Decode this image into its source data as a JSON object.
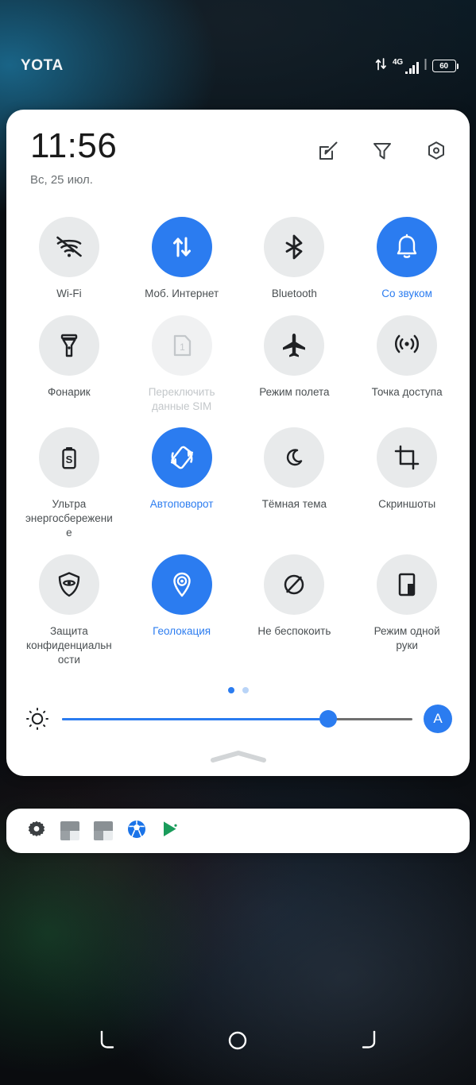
{
  "statusbar": {
    "carrier": "YOTA",
    "network_type": "4G",
    "battery_level": "60",
    "data_icon": "data-transfer-icon"
  },
  "panel": {
    "clock": "11:56",
    "date": "Вс, 25 июл.",
    "actions": [
      {
        "name": "edit-tiles-icon",
        "label": "Изменить"
      },
      {
        "name": "filter-icon",
        "label": "Фильтр"
      },
      {
        "name": "settings-icon",
        "label": "Настройки"
      }
    ]
  },
  "tiles": [
    {
      "label": "Wi-Fi",
      "icon": "wifi-off-icon",
      "state": "off"
    },
    {
      "label": "Моб. Интернет",
      "icon": "mobile-data-icon",
      "state": "on"
    },
    {
      "label": "Bluetooth",
      "icon": "bluetooth-icon",
      "state": "off"
    },
    {
      "label": "Со звуком",
      "icon": "bell-icon",
      "state": "on"
    },
    {
      "label": "Фонарик",
      "icon": "flashlight-icon",
      "state": "off"
    },
    {
      "label": "Переключить данные SIM",
      "icon": "sim-card-icon",
      "state": "disabled"
    },
    {
      "label": "Режим полета",
      "icon": "airplane-icon",
      "state": "off"
    },
    {
      "label": "Точка доступа",
      "icon": "hotspot-icon",
      "state": "off"
    },
    {
      "label": "Ультра энергосбережение",
      "icon": "battery-saver-icon",
      "state": "off"
    },
    {
      "label": "Автоповорот",
      "icon": "auto-rotate-icon",
      "state": "on"
    },
    {
      "label": "Тёмная тема",
      "icon": "moon-icon",
      "state": "off"
    },
    {
      "label": "Скриншоты",
      "icon": "screenshot-crop-icon",
      "state": "off"
    },
    {
      "label": "Защита конфиденциальности",
      "icon": "shield-eye-icon",
      "state": "off"
    },
    {
      "label": "Геолокация",
      "icon": "location-pin-icon",
      "state": "on"
    },
    {
      "label": "Не беспокоить",
      "icon": "do-not-disturb-icon",
      "state": "off"
    },
    {
      "label": "Режим одной руки",
      "icon": "one-hand-mode-icon",
      "state": "off"
    }
  ],
  "pager": {
    "count": 2,
    "active_index": 0
  },
  "brightness": {
    "icon": "brightness-sun-icon",
    "value_percent": 76,
    "auto_label": "A",
    "auto_enabled": true
  },
  "collapse_handle": "collapse-chevron-icon",
  "notification_shelf": {
    "icons": [
      {
        "name": "settings-gear-icon"
      },
      {
        "name": "app-placeholder-icon"
      },
      {
        "name": "app-placeholder-icon"
      },
      {
        "name": "soccer-ball-icon"
      },
      {
        "name": "play-store-icon"
      }
    ]
  },
  "navbar": {
    "buttons": [
      {
        "name": "back-button",
        "label": "Назад"
      },
      {
        "name": "home-button",
        "label": "Главный экран"
      },
      {
        "name": "recents-button",
        "label": "Последние приложения"
      }
    ]
  },
  "colors": {
    "accent": "#2b7cf0",
    "tile_off_bg": "#e8eaeb",
    "panel_bg": "#ffffff",
    "label": "#4a4f52"
  }
}
